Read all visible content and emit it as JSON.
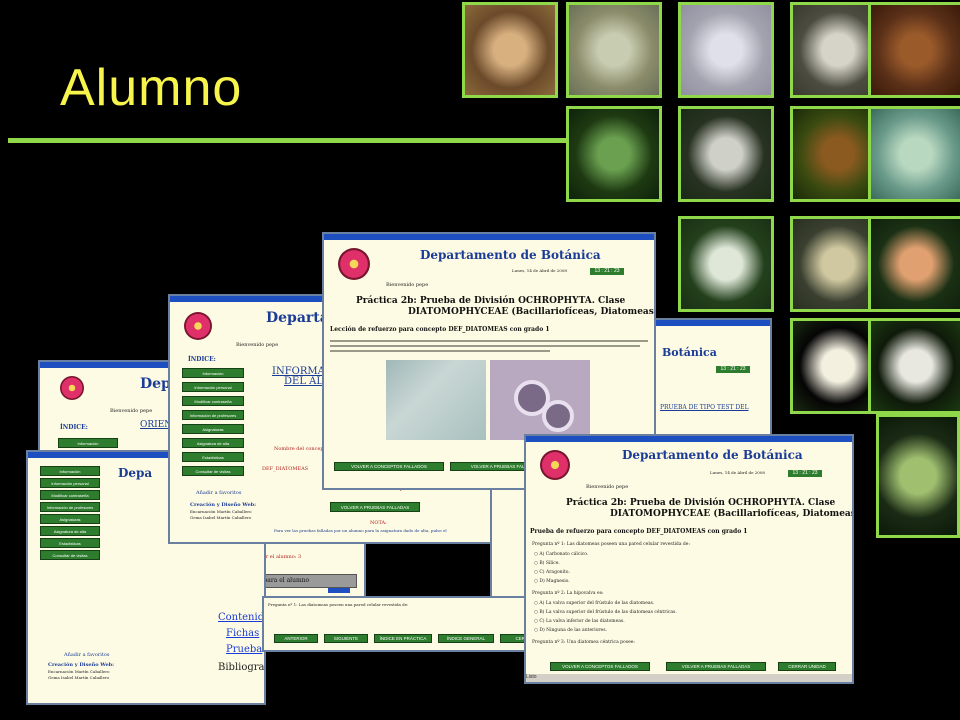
{
  "slide": {
    "title": "Alumno"
  },
  "thumbnails": [
    "straw-sample",
    "diatom-drawing",
    "pollen-grain",
    "mold-spores",
    "brown-soil",
    "grass-stems",
    "oyster-mushrooms",
    "moss-sporophytes",
    "green-algae",
    "white-lichen",
    "lichen-disc",
    "pine-cone",
    "white-water-lily",
    "white-flowers",
    "ginkgo-leaves"
  ],
  "dept": {
    "name": "Departamento de Botánica",
    "short": "Departa",
    "short2": "Depa",
    "short3": "Botánica"
  },
  "date": {
    "text": "Lunes, 14 de Abril de 2008",
    "time": "13 : 21 : 23"
  },
  "welcome": "Bienvenido pepe",
  "nav": {
    "index_label": "ÍNDICE:",
    "items": [
      "Información",
      "Información personal",
      "Modificar contraseña",
      "Información de profesores",
      "Asignaturas",
      "Asignatura de alta",
      "Estadísticas",
      "Consultar de visitas"
    ],
    "favorites": "Añadir a favoritos",
    "credits_title": "Creación y Diseño Web:",
    "credits_1": "Encarnación Martín Caballero",
    "credits_2": "Gema Isabel Martín Caballero"
  },
  "practice": {
    "title_1": "Práctica 2b: Prueba de División OCHROPHYTA. Clase",
    "title_2": "DIATOMOPHYCEAE (Bacillariofíceas, Diatomeas)",
    "lesson": "Lección de refuerzo para concepto DEF_DIATOMEAS con grado 1",
    "test": "Prueba de refuerzo para concepto DEF_DIATOMEAS con grado 1"
  },
  "questions": [
    {
      "q": "Pregunta nº 1: Las diatomeas poseen una pared celular revestida de:",
      "options": [
        "A) Carbonato cálcico.",
        "B) Sílice.",
        "C) Aragonito.",
        "D) Magnesio."
      ]
    },
    {
      "q": "Pregunta nº 2: La hipovalva es:",
      "options": [
        "A) La valva superior del frústulo de las diatomeas.",
        "B) La valva superior del frústulo de las diatomeas céntricas.",
        "C) La valva inferior de las diatomeas.",
        "D) Ninguna de las anteriores."
      ]
    },
    {
      "q": "Pregunta nº 3: Una diatomea céntrica posee:",
      "options": []
    }
  ],
  "buttons": {
    "back_failed": "VOLVER A CONCEPTOS FALLADOS",
    "back_tests": "VOLVER A PRUEBAS FALLADAS",
    "finish": "CERRAR SESIÓN",
    "previous": "ANTERIOR",
    "next": "SIGUIENTE",
    "index": "ÍNDICE EN PRÁCTICA",
    "general": "ÍNDICE GENERAL",
    "close": "CERRAR",
    "back_failed_2": "VOLVER A PRUEBAS FALLADAS",
    "final": "CERRAR UNIDAD"
  },
  "other": {
    "info_1": "INFORMACI",
    "info_2": "DEL ALUM",
    "orient": "ORIENT",
    "tipo_test": "PRUEBA DE TIPO TEST DEL",
    "failed_concepts": "Número total de conceptos fallados: 1",
    "volver_pruebas": "VOLVER A PRUEBAS FALLADAS",
    "nota": "NOTA:",
    "num_pruebas": "Número de pruebas realizadas por el alumno: 3",
    "notas": "Notas obtenidas para el alumno",
    "contenidos": "Contenido",
    "fichas": "Fichas",
    "prueba": "Prueba",
    "bibliografia": "Bibliografía",
    "def_diatomeas": "DEF_DIATOMEAS",
    "nombre_concepto": "Nombre del concepto",
    "para_ver": "Para ver las pruebas falladas por un alumno para la asignatura dado de alta, pulse el"
  },
  "status": {
    "done": "Listo",
    "local": "Internet"
  }
}
